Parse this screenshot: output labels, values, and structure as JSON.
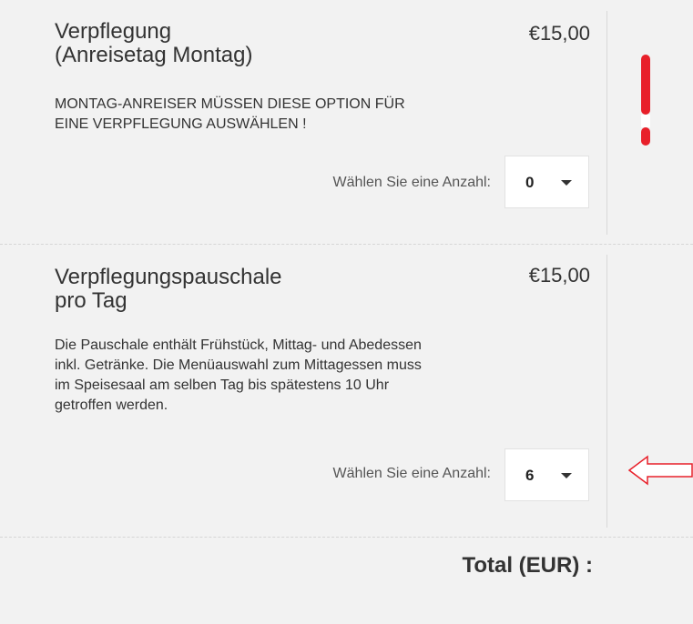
{
  "items": [
    {
      "name_line1": "Verpflegung",
      "name_line2": "(Anreisetag Montag)",
      "price": "€15,00",
      "desc_lines": [
        "MONTAG-ANREISER MÜSSEN DIESE OPTION FÜR",
        "EINE VERPFLEGUNG AUSWÄHLEN !"
      ],
      "qty_label": "Wählen Sie eine Anzahl:",
      "qty_value": "0"
    },
    {
      "name_line1": "Verpflegungspauschale",
      "name_line2": "pro Tag",
      "price": "€15,00",
      "desc_lines": [
        "Die Pauschale enthält Frühstück, Mittag- und Abedessen",
        "inkl. Getränke. Die Menüauswahl zum Mittagessen muss",
        "im Speisesaal am selben Tag bis spätestens 10 Uhr",
        "getroffen werden."
      ],
      "qty_label": "Wählen Sie eine Anzahl:",
      "qty_value": "6"
    }
  ],
  "total_label": "Total (EUR) :",
  "annotations": {
    "exclamation_color": "#e8202a",
    "arrow_color": "#e8202a"
  }
}
